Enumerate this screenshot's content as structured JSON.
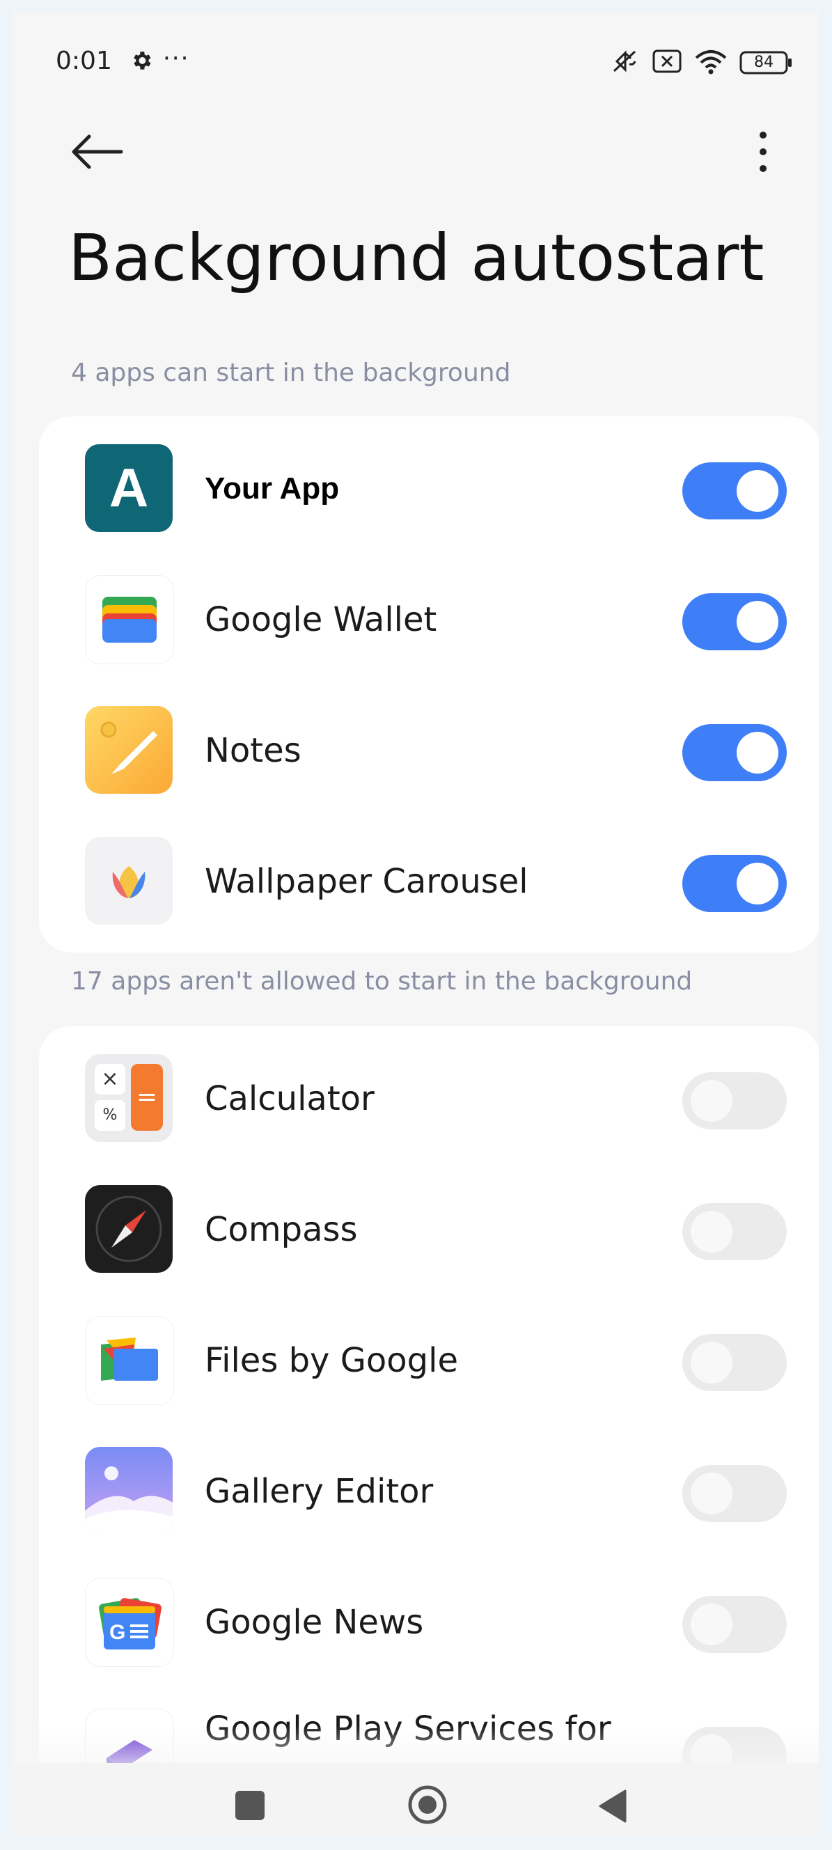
{
  "status_bar": {
    "time": "0:01",
    "more": "···",
    "battery": "84"
  },
  "page": {
    "title": "Background autostart"
  },
  "allowed": {
    "label": "4 apps can start in the background",
    "apps": [
      {
        "name": "Your App",
        "enabled": true
      },
      {
        "name": "Google Wallet",
        "enabled": true
      },
      {
        "name": "Notes",
        "enabled": true
      },
      {
        "name": "Wallpaper Carousel",
        "enabled": true
      }
    ]
  },
  "disallowed": {
    "label": "17 apps aren't allowed to start in the background",
    "apps": [
      {
        "name": "Calculator",
        "enabled": false
      },
      {
        "name": "Compass",
        "enabled": false
      },
      {
        "name": "Files by Google",
        "enabled": false
      },
      {
        "name": "Gallery Editor",
        "enabled": false
      },
      {
        "name": "Google News",
        "enabled": false
      },
      {
        "name": "Google Play Services for",
        "enabled": false
      }
    ]
  },
  "icons": {
    "your_app_letter": "A",
    "news_letters": "G",
    "calc_x": "×",
    "calc_pct": "%",
    "calc_eq": "="
  },
  "colors": {
    "toggle_on": "#3e7ef7",
    "toggle_off": "#ebebeb",
    "your_app_tile": "#0f6775"
  }
}
